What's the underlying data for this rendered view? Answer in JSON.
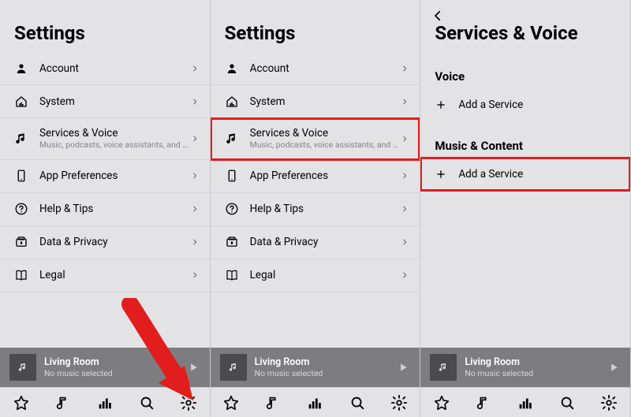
{
  "screens": {
    "s1": {
      "title": "Settings",
      "rows": {
        "account": {
          "label": "Account"
        },
        "system": {
          "label": "System"
        },
        "services": {
          "label": "Services & Voice",
          "sublabel": "Music, podcasts, voice assistants, and more"
        },
        "apppref": {
          "label": "App Preferences"
        },
        "help": {
          "label": "Help & Tips"
        },
        "privacy": {
          "label": "Data & Privacy"
        },
        "legal": {
          "label": "Legal"
        }
      }
    },
    "s2": {
      "title": "Settings",
      "rows": {
        "account": {
          "label": "Account"
        },
        "system": {
          "label": "System"
        },
        "services": {
          "label": "Services & Voice",
          "sublabel": "Music, podcasts, voice assistants, and more"
        },
        "apppref": {
          "label": "App Preferences"
        },
        "help": {
          "label": "Help & Tips"
        },
        "privacy": {
          "label": "Data & Privacy"
        },
        "legal": {
          "label": "Legal"
        }
      }
    },
    "s3": {
      "title": "Services & Voice",
      "sections": {
        "voice": {
          "heading": "Voice",
          "add": "Add a Service"
        },
        "music": {
          "heading": "Music & Content",
          "add": "Add a Service"
        }
      }
    }
  },
  "now_playing": {
    "room": "Living Room",
    "status": "No music selected"
  }
}
